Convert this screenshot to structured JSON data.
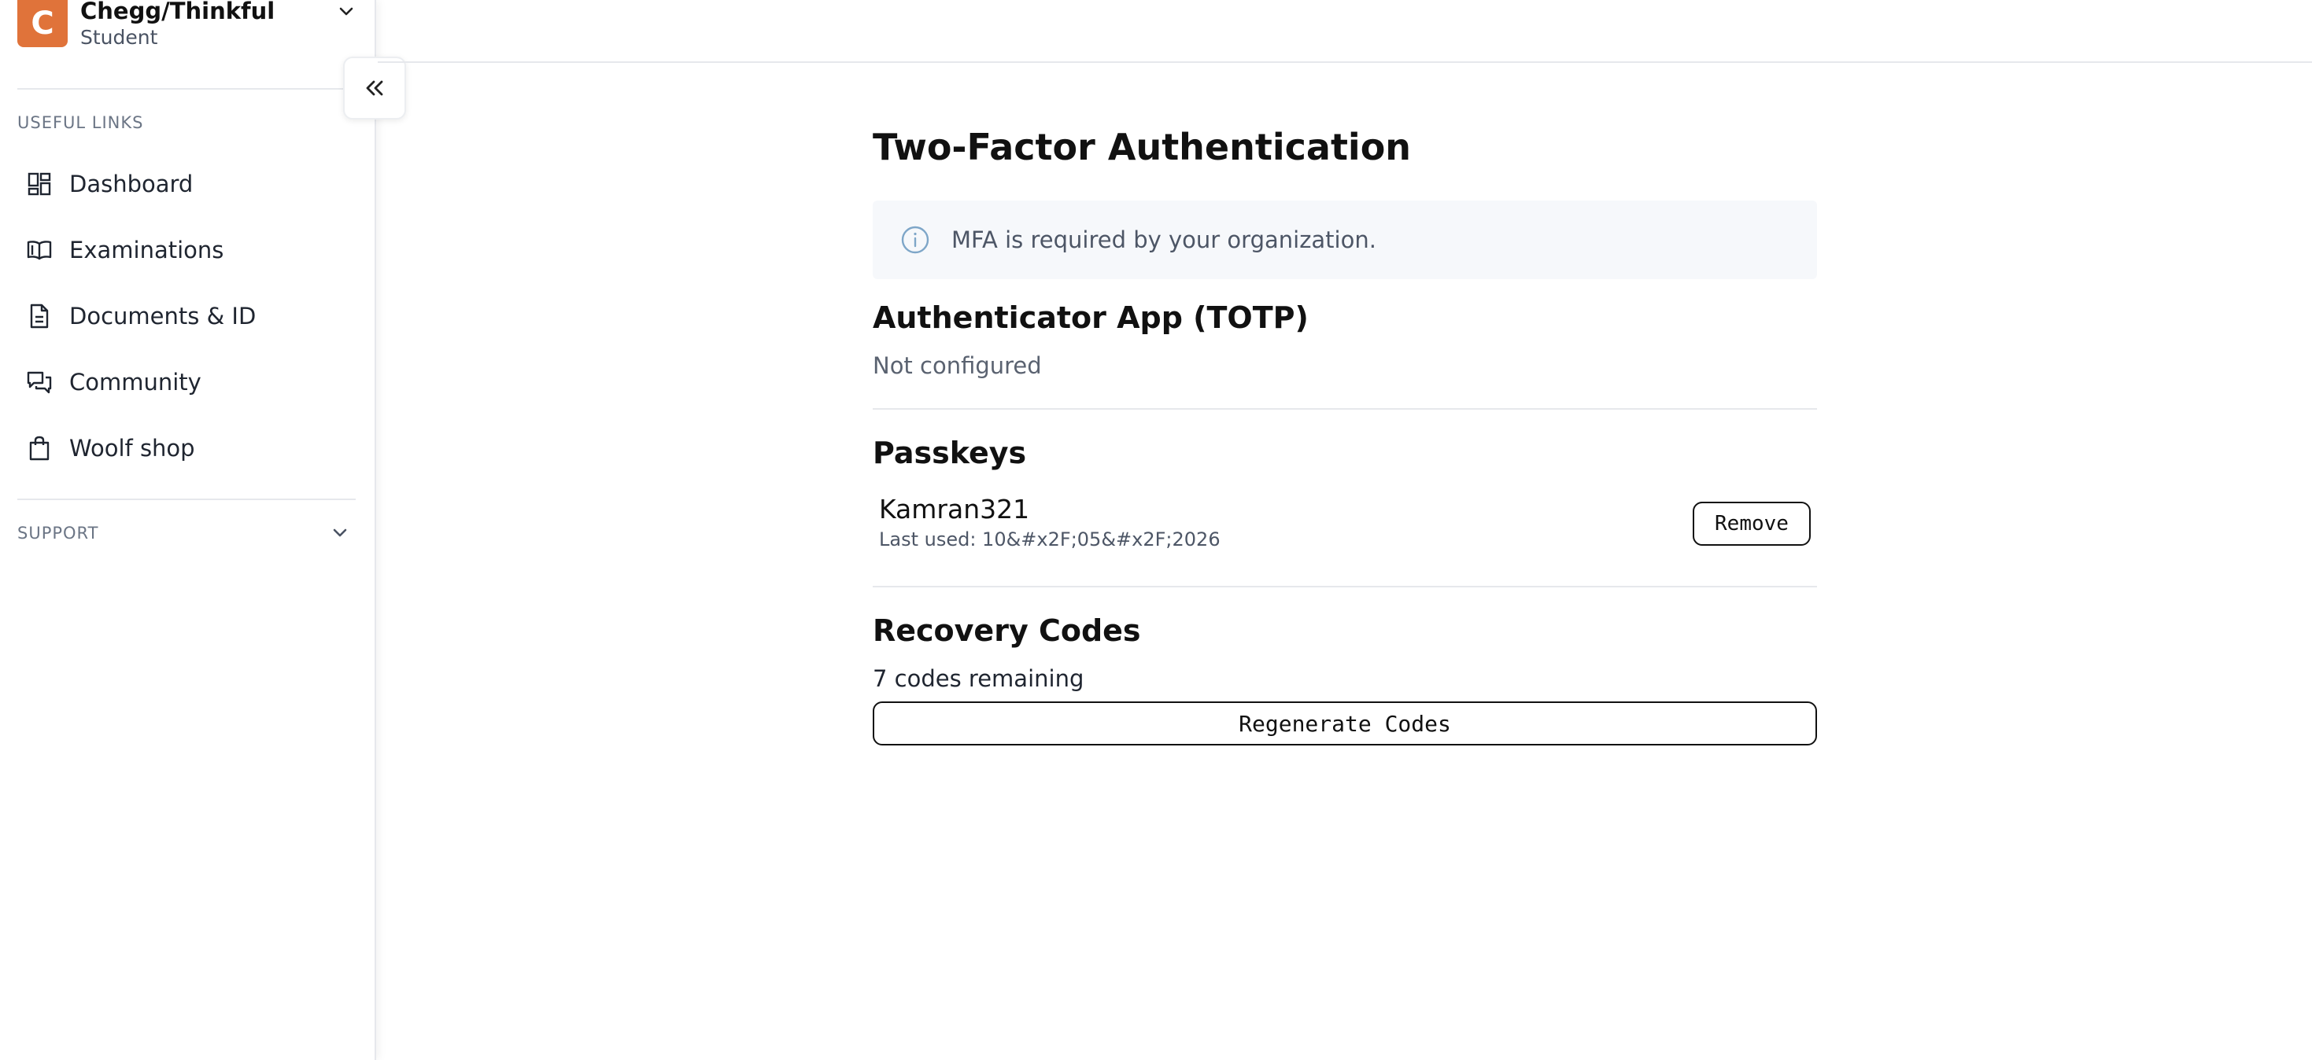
{
  "org": {
    "logo_letter": "C",
    "name": "Chegg/Thinkful",
    "role": "Student",
    "switch_icon": "chevron-down-icon"
  },
  "sidebar": {
    "useful_links_label": "USEFUL LINKS",
    "items": [
      {
        "label": "Dashboard",
        "icon": "dashboard-icon"
      },
      {
        "label": "Examinations",
        "icon": "book-icon"
      },
      {
        "label": "Documents & ID",
        "icon": "document-icon"
      },
      {
        "label": "Community",
        "icon": "chat-icon"
      },
      {
        "label": "Woolf shop",
        "icon": "shopping-bag-icon"
      }
    ],
    "support_label": "SUPPORT",
    "collapse_icon": "double-chevron-left-icon"
  },
  "main": {
    "title": "Two-Factor Authentication",
    "banner": {
      "icon": "info-icon",
      "text": "MFA is required by your organization."
    },
    "totp": {
      "title": "Authenticator App (TOTP)",
      "status": "Not configured"
    },
    "passkeys": {
      "title": "Passkeys",
      "items": [
        {
          "name": "Kamran321",
          "last_used": "Last used: 10&#x2F;05&#x2F;2026",
          "remove_label": "Remove"
        }
      ]
    },
    "recovery": {
      "title": "Recovery Codes",
      "remaining": "7 codes remaining",
      "regenerate_label": "Regenerate Codes"
    }
  },
  "colors": {
    "brand_orange": "#e0733a",
    "info_blue": "#7ea6c8"
  }
}
